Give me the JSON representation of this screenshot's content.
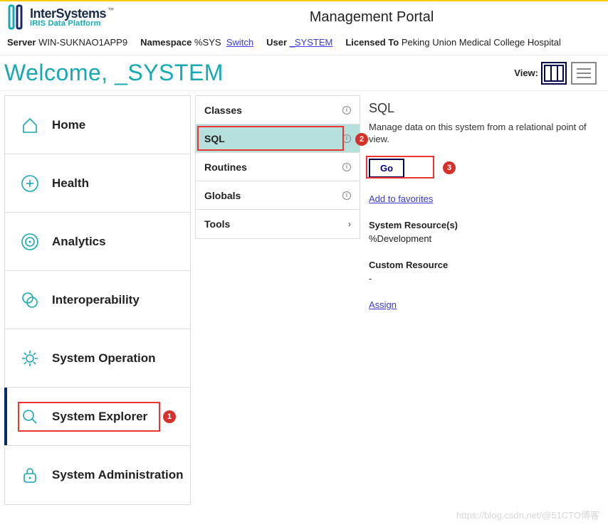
{
  "header": {
    "brand_main": "InterSystems",
    "brand_sub": "IRIS Data Platform",
    "tm": "™",
    "portal_title": "Management Portal"
  },
  "infobar": {
    "server_label": "Server",
    "server_value": "WIN-SUKNAO1APP9",
    "namespace_label": "Namespace",
    "namespace_value": "%SYS",
    "switch_link": "Switch",
    "user_label": "User",
    "user_value": "_SYSTEM",
    "licensed_label": "Licensed To",
    "licensed_value": "Peking Union Medical College Hospital"
  },
  "welcome": {
    "text": "Welcome, _SYSTEM",
    "view_label": "View:"
  },
  "nav": [
    {
      "label": "Home"
    },
    {
      "label": "Health"
    },
    {
      "label": "Analytics"
    },
    {
      "label": "Interoperability"
    },
    {
      "label": "System Operation"
    },
    {
      "label": "System Explorer"
    },
    {
      "label": "System Administration"
    }
  ],
  "submenu": [
    {
      "label": "Classes",
      "type": "info"
    },
    {
      "label": "SQL",
      "type": "info",
      "selected": true
    },
    {
      "label": "Routines",
      "type": "info"
    },
    {
      "label": "Globals",
      "type": "info"
    },
    {
      "label": "Tools",
      "type": "chev"
    }
  ],
  "detail": {
    "title": "SQL",
    "desc": "Manage data on this system from a relational point of view.",
    "go": "Go",
    "fav_link": "Add to favorites",
    "sysres_h": "System Resource(s)",
    "sysres_v": "%Development",
    "custres_h": "Custom Resource",
    "custres_v": "-",
    "assign": "Assign"
  },
  "badges": {
    "b1": "1",
    "b2": "2",
    "b3": "3"
  },
  "watermark": "https://blog.csdn.net/@51CTO博客"
}
